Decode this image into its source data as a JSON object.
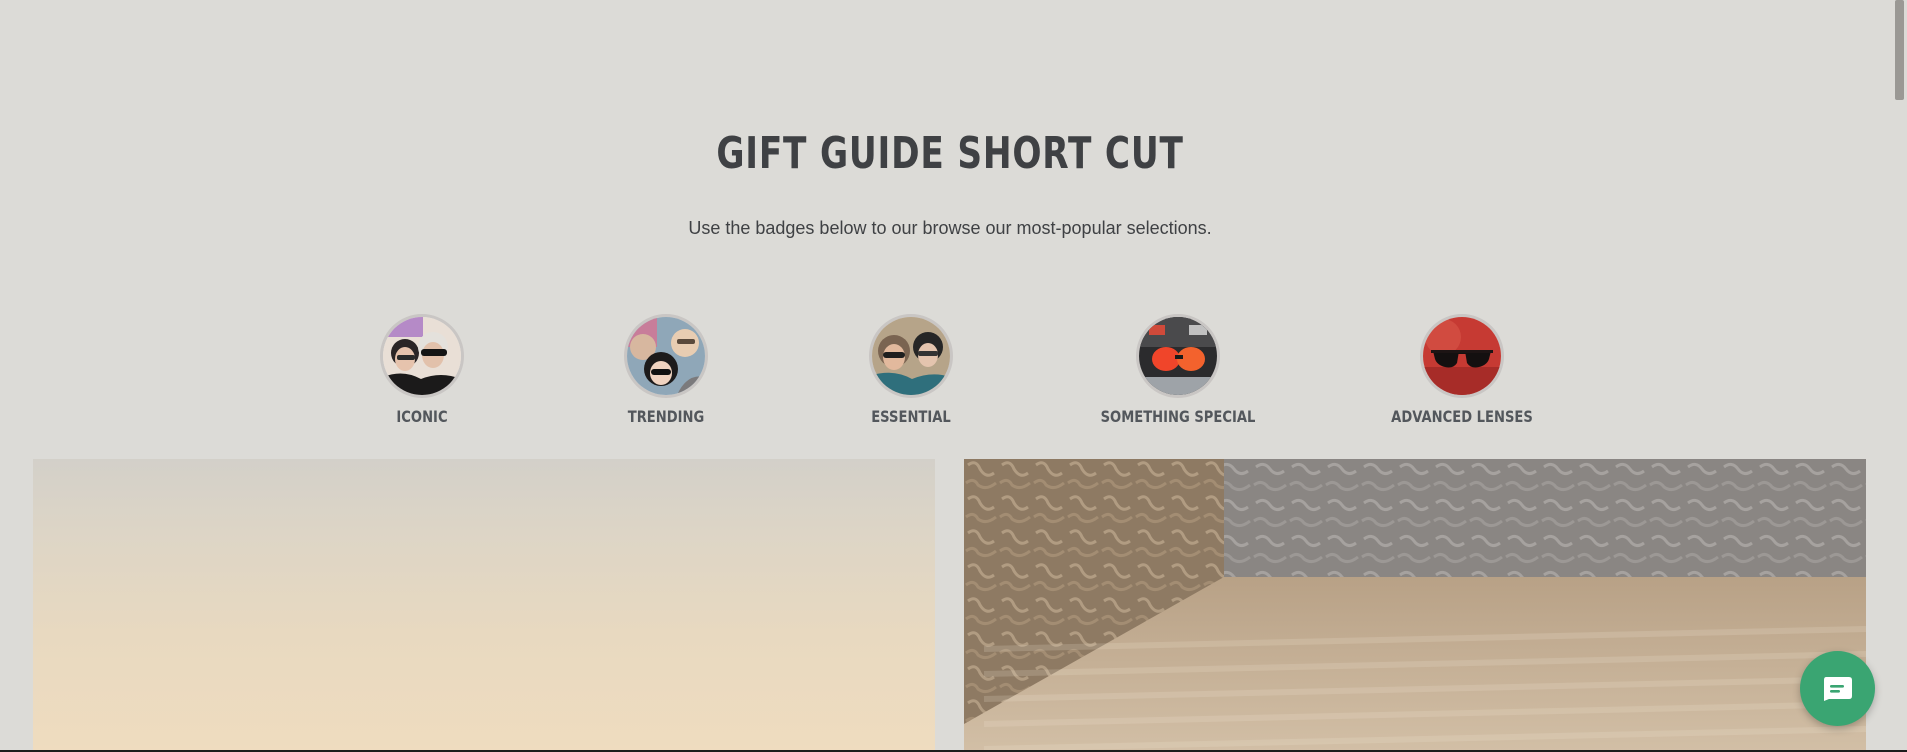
{
  "section": {
    "title": "GIFT GUIDE SHORT CUT",
    "subtitle": "Use the badges below to our browse our most-popular selections."
  },
  "badges": [
    {
      "label": "ICONIC",
      "icon": "iconic-badge-image"
    },
    {
      "label": "TRENDING",
      "icon": "trending-badge-image"
    },
    {
      "label": "ESSENTIAL",
      "icon": "essential-badge-image"
    },
    {
      "label": "SOMETHING SPECIAL",
      "icon": "something-special-badge-image"
    },
    {
      "label": "ADVANCED LENSES",
      "icon": "advanced-lenses-badge-image"
    }
  ],
  "colors": {
    "background": "#dcdbd7",
    "heading": "#3f4144",
    "badge_label": "#53575c",
    "chat_button": "#3aa572"
  },
  "chat": {
    "icon": "chat-bubble-icon"
  }
}
